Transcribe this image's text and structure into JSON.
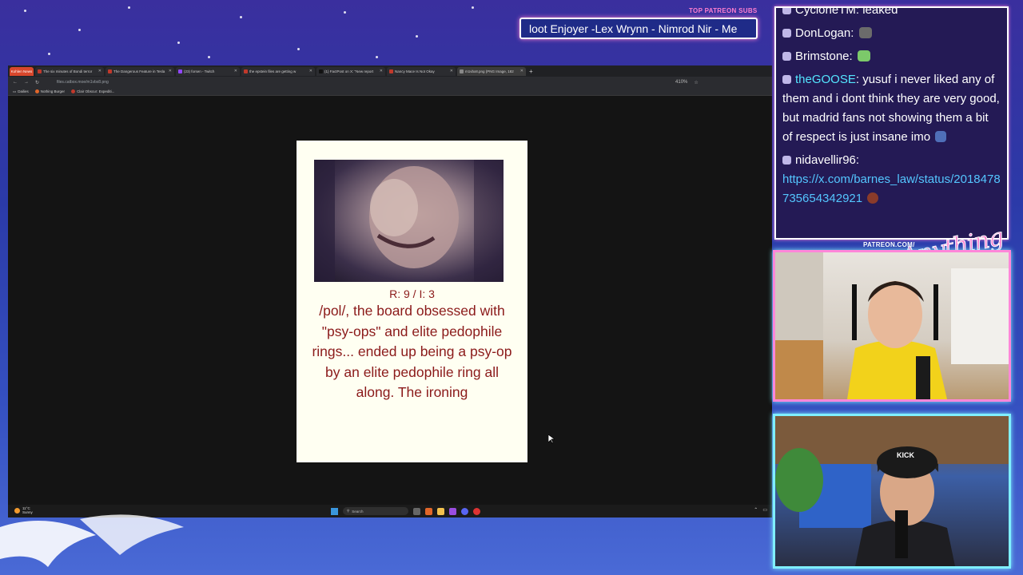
{
  "overlay": {
    "patreon_label": "TOP PATREON SUBS",
    "ticker_text": "loot Enjoyer -Lex Wrynn - Nimrod Nir - Me",
    "patreon_url": "PATREON.COM/",
    "brand_script": "Anything Else"
  },
  "browser": {
    "tab_group": "Kohlen News",
    "tabs": [
      {
        "title": "The six minutes of Bondi terror"
      },
      {
        "title": "The Dangerous Feature in Tesla"
      },
      {
        "title": "(23) forsen - Twitch"
      },
      {
        "title": "the epstein files are getting w"
      },
      {
        "title": "(1) FactPost on X: \"New report"
      },
      {
        "title": "Nancy Mace Is Not Okay"
      },
      {
        "title": "m1vbx8.png (PNG Image, 182"
      }
    ],
    "url": "files.catbox.moe/m1vbx8.png",
    "zoom": "410%",
    "bookmarks": [
      {
        "label": "Dailies"
      },
      {
        "label": "Nothing Burger"
      },
      {
        "label": "Clair Obscur: Expediti..."
      }
    ]
  },
  "meme": {
    "meta": "R: 9 / I: 3",
    "caption": "/pol/, the board obsessed with \"psy-ops\" and elite pedophile rings... ended up being a psy-op by an elite pedophile ring all along. The ironing"
  },
  "taskbar": {
    "temp": "11°C",
    "condition": "Sunny",
    "search_label": "Search"
  },
  "chat": {
    "messages": [
      {
        "user": "CycloneTM",
        "text": "leaked"
      },
      {
        "user": "DonLogan",
        "text": ""
      },
      {
        "user": "Brimstone",
        "text": ""
      },
      {
        "user": "theGOOSE",
        "text": "yusuf i never liked any of them and i dont think they are very good, but madrid fans not showing them a bit of respect is just insane imo"
      },
      {
        "user": "nidavellir96",
        "text": "https://x.com/barnes_law/status/2018478735654342921"
      }
    ]
  },
  "webcam": {
    "cap_text": "KICK"
  }
}
